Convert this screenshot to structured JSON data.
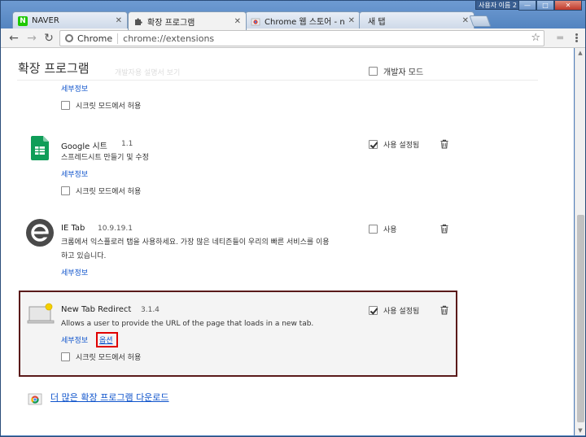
{
  "window": {
    "user_badge": "사용자 이름 2",
    "controls": {
      "minimize": "—",
      "maximize": "□",
      "close": "✕"
    }
  },
  "tabs": [
    {
      "label": "NAVER",
      "favicon": "naver-icon",
      "color": "#1ec800"
    },
    {
      "label": "확장 프로그램",
      "favicon": "puzzle-icon",
      "active": true
    },
    {
      "label": "Chrome 웹 스토어 - ne",
      "favicon": "chrome-store-icon"
    },
    {
      "label": "새 탭",
      "favicon": ""
    }
  ],
  "toolbar": {
    "back": "←",
    "forward": "→",
    "reload": "↻",
    "omnibox_scheme": "Chrome",
    "omnibox_url": "chrome://extensions",
    "star": "☆"
  },
  "page": {
    "title": "확장 프로그램",
    "dev_mode_label": "개발자 모드",
    "dev_mode_checked": false,
    "ghost_text": "개발자용 설명서 보기"
  },
  "extensions": [
    {
      "id": "partial-top",
      "details_label": "세부정보",
      "incognito_label": "시크릿 모드에서 허용"
    },
    {
      "id": "google-sheets",
      "name": "Google 시트",
      "version": "1.1",
      "description": "스프레드시트 만들기 및 수정",
      "details_label": "세부정보",
      "incognito_label": "시크릿 모드에서 허용",
      "status_label": "사용 설정됨",
      "enabled": true,
      "icon": "sheets-icon",
      "icon_color": "#0f9d58"
    },
    {
      "id": "ie-tab",
      "name": "IE Tab",
      "version": "10.9.19.1",
      "description_line1": "크롬에서 익스플로러 탭을 사용하세요. 가장 많은 네티즌들이 우리의 빠른 서비스를 이용",
      "description_line2": "하고 있습니다.",
      "details_label": "세부정보",
      "status_label": "사용",
      "enabled": false,
      "icon": "ie-tab-icon",
      "icon_color": "#4a4a4a"
    },
    {
      "id": "new-tab-redirect",
      "name": "New Tab Redirect",
      "version": "3.1.4",
      "description": "Allows a user to provide the URL of the page that loads in a new tab.",
      "details_label": "세부정보",
      "options_label": "옵션",
      "incognito_label": "시크릿 모드에서 허용",
      "status_label": "사용 설정됨",
      "enabled": true,
      "icon": "new-tab-redirect-icon",
      "highlight_color": "#5a1a1a",
      "options_highlight_color": "#e00000"
    }
  ],
  "more_extensions_link": "더 많은 확장 프로그램 다운로드"
}
